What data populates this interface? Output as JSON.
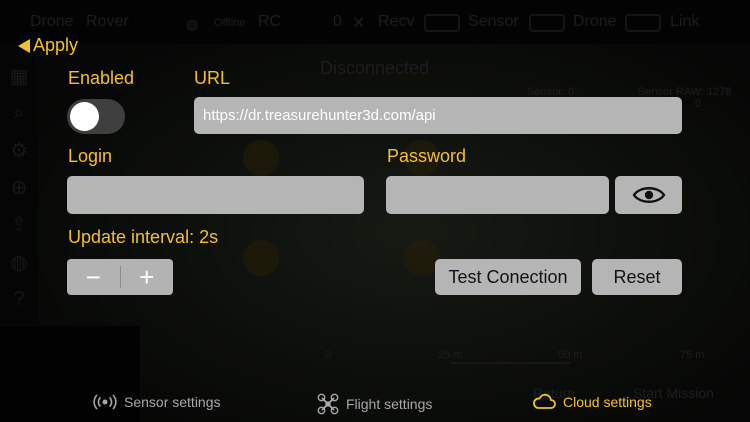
{
  "background": {
    "title_drone": "Drone",
    "title_rover": "Rover",
    "status_offline": "Offline",
    "status_rc": "RC",
    "status_zero": "0",
    "status_recv": "Recv",
    "status_sensor": "Sensor",
    "status_drone": "Drone",
    "status_link": "Link",
    "connection": "Disconnected",
    "sensor_label": "Sensor: 0",
    "sensor_raw_label": "Sensor RAW: 1278",
    "sensor_raw_value": "0",
    "scale_0": "0",
    "scale_25": "25 m",
    "scale_50": "50 m",
    "scale_75": "75 m",
    "return_btn": "Return",
    "start_mission_btn": "Start Mission"
  },
  "apply_label": "Apply",
  "enabled_label": "Enabled",
  "enabled": false,
  "url_label": "URL",
  "url_value": "https://dr.treasurehunter3d.com/api",
  "login_label": "Login",
  "login_value": "",
  "password_label": "Password",
  "password_value": "",
  "update_interval_label": "Update interval: 2s",
  "stepper": {
    "minus": "−",
    "plus": "+"
  },
  "test_connection_label": "Test Conection",
  "reset_label": "Reset",
  "tabs": [
    {
      "label": "Sensor settings",
      "icon": "sensor-waves-icon",
      "active": false
    },
    {
      "label": "Flight settings",
      "icon": "drone-icon",
      "active": false
    },
    {
      "label": "Cloud settings",
      "icon": "cloud-icon",
      "active": true
    }
  ],
  "colors": {
    "accent": "#f6c02c",
    "field_bg": "#b5b5b5",
    "inactive_tab": "#a8a8a8"
  }
}
